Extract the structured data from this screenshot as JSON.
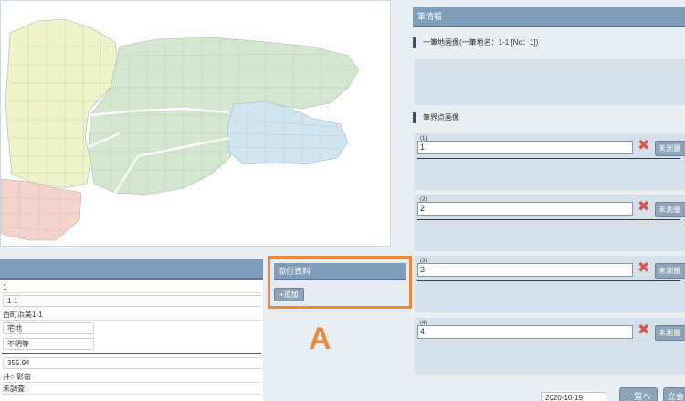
{
  "map": {
    "colors": {
      "yellow": "#eef3c9",
      "green": "#d3e7cf",
      "blue": "#cfe6f2",
      "pink": "#f5d3cd",
      "stroke": "#a9b8a6"
    }
  },
  "info": {
    "rows": [
      "1",
      "1-1",
      "西町浜美1-1",
      "宅地",
      "不明等",
      "355.94",
      "井○ 彰南",
      "未調査"
    ]
  },
  "attachment": {
    "title": "添付資料",
    "add_button": "+追加",
    "marker_letter": "A"
  },
  "parcel": {
    "title": "筆情報",
    "image_label": "一筆地画像(一筆地名：1-1 [No：1])",
    "boundary_label": "筆界点画像",
    "points": [
      {
        "num": "(1)",
        "value": "1",
        "button": "未測量"
      },
      {
        "num": "(2)",
        "value": "2",
        "button": "未測量"
      },
      {
        "num": "(3)",
        "value": "3",
        "button": "未測量"
      },
      {
        "num": "(4)",
        "value": "4",
        "button": "未測量"
      }
    ]
  },
  "footer": {
    "date": "2020-10-19",
    "list_button": "一覧へ",
    "witness_button": "立会"
  }
}
